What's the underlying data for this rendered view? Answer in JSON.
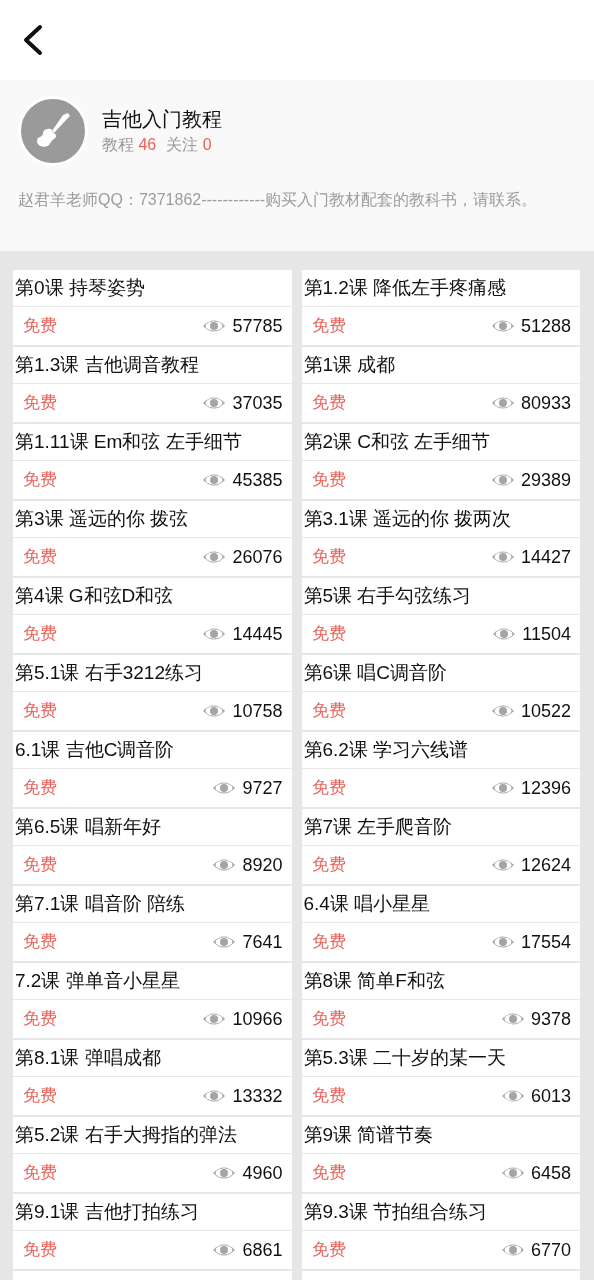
{
  "header": {
    "title": "吉他入门教程",
    "stats": [
      {
        "label": "教程",
        "value": "46"
      },
      {
        "label": "关注",
        "value": "0"
      }
    ],
    "description": "赵君羊老师QQ：7371862------------购买入门教材配套的教科书，请联系。"
  },
  "lessons": [
    {
      "title": "第0课 持琴姿势",
      "price": "免费",
      "views": "57785"
    },
    {
      "title": "第1.2课 降低左手疼痛感",
      "price": "免费",
      "views": "51288"
    },
    {
      "title": "第1.3课 吉他调音教程",
      "price": "免费",
      "views": "37035"
    },
    {
      "title": "第1课 成都",
      "price": "免费",
      "views": "80933"
    },
    {
      "title": "第1.11课 Em和弦 左手细节",
      "price": "免费",
      "views": "45385"
    },
    {
      "title": "第2课 C和弦 左手细节",
      "price": "免费",
      "views": "29389"
    },
    {
      "title": "第3课 遥远的你 拨弦",
      "price": "免费",
      "views": "26076"
    },
    {
      "title": "第3.1课 遥远的你 拨两次",
      "price": "免费",
      "views": "14427"
    },
    {
      "title": "第4课 G和弦D和弦",
      "price": "免费",
      "views": "14445"
    },
    {
      "title": "第5课 右手勾弦练习",
      "price": "免费",
      "views": "11504"
    },
    {
      "title": "第5.1课 右手3212练习",
      "price": "免费",
      "views": "10758"
    },
    {
      "title": "第6课 唱C调音阶",
      "price": "免费",
      "views": "10522"
    },
    {
      "title": "6.1课 吉他C调音阶",
      "price": "免费",
      "views": "9727"
    },
    {
      "title": "第6.2课 学习六线谱",
      "price": "免费",
      "views": "12396"
    },
    {
      "title": "第6.5课 唱新年好",
      "price": "免费",
      "views": "8920"
    },
    {
      "title": "第7课 左手爬音阶",
      "price": "免费",
      "views": "12624"
    },
    {
      "title": "第7.1课 唱音阶 陪练",
      "price": "免费",
      "views": "7641"
    },
    {
      "title": "6.4课 唱小星星",
      "price": "免费",
      "views": "17554"
    },
    {
      "title": "7.2课 弹单音小星星",
      "price": "免费",
      "views": "10966"
    },
    {
      "title": "第8课 简单F和弦",
      "price": "免费",
      "views": "9378"
    },
    {
      "title": "第8.1课 弹唱成都",
      "price": "免费",
      "views": "13332"
    },
    {
      "title": "第5.3课 二十岁的某一天",
      "price": "免费",
      "views": "6013"
    },
    {
      "title": "第5.2课 右手大拇指的弹法",
      "price": "免费",
      "views": "4960"
    },
    {
      "title": "第9课 简谱节奏",
      "price": "免费",
      "views": "6458"
    },
    {
      "title": "第9.1课 吉他打拍练习",
      "price": "免费",
      "views": "6861"
    },
    {
      "title": "第9.3课 节拍组合练习",
      "price": "免费",
      "views": "6770"
    }
  ]
}
